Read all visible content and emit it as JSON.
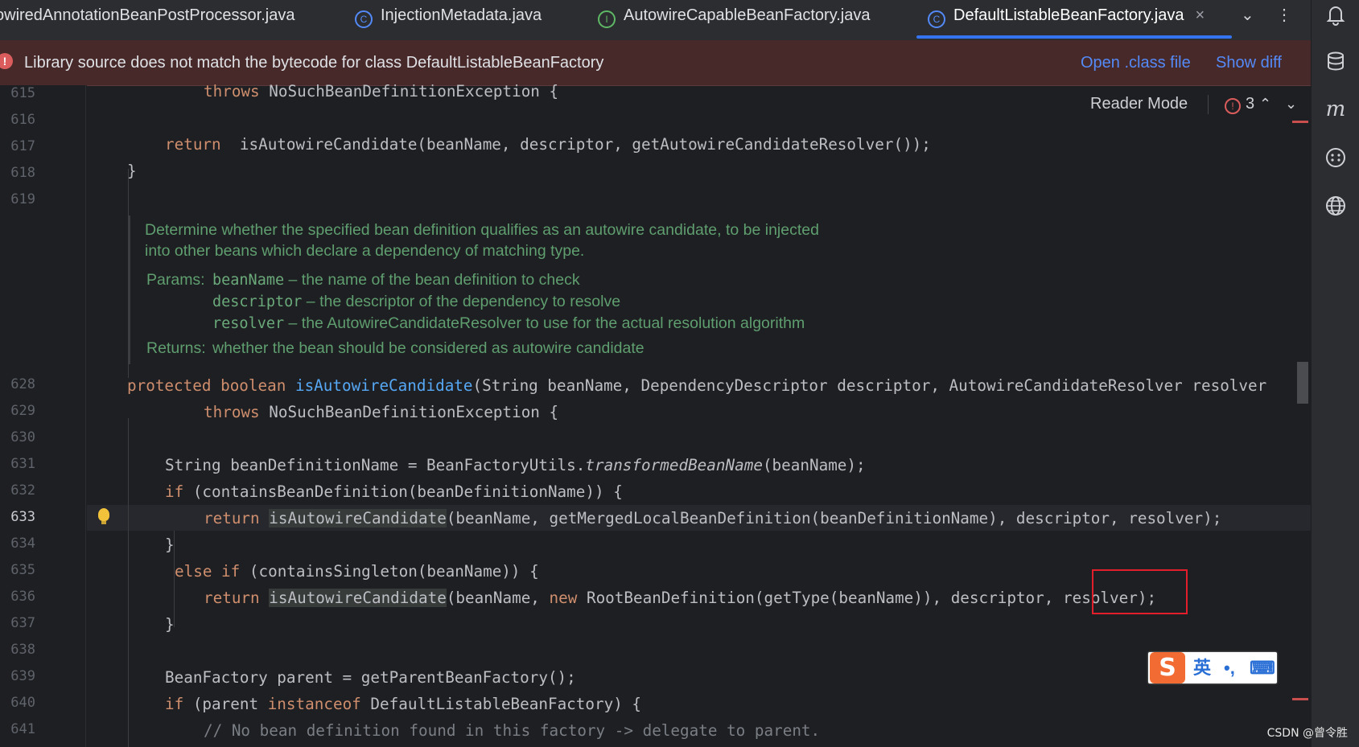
{
  "tabs": [
    {
      "label": "owiredAnnotationBeanPostProcessor.java",
      "icon": "class-icon"
    },
    {
      "label": "InjectionMetadata.java",
      "icon": "class-icon"
    },
    {
      "label": "AutowireCapableBeanFactory.java",
      "icon": "interface-icon"
    },
    {
      "label": "DefaultListableBeanFactory.java",
      "icon": "class-icon",
      "active": true
    }
  ],
  "icon_glyphs": {
    "class": "C",
    "interface": "I",
    "close": "×",
    "chevron": "⌄",
    "more": "⋮"
  },
  "banner": {
    "message": "Library source does not match the bytecode for class DefaultListableBeanFactory",
    "open_class": "Open .class file",
    "show_diff": "Show diff"
  },
  "reader_mode": "Reader Mode",
  "error_count": "3",
  "lines": {
    "l615": "615",
    "l616": "616",
    "l617": "617",
    "l618": "618",
    "l619": "619",
    "l628": "628",
    "l629": "629",
    "l630": "630",
    "l631": "631",
    "l632": "632",
    "l633": "633",
    "l634": "634",
    "l635": "635",
    "l636": "636",
    "l637": "637",
    "l638": "638",
    "l639": "639",
    "l640": "640",
    "l641": "641"
  },
  "doc": {
    "line1": "Determine whether the specified bean definition qualifies as an autowire candidate, to be injected",
    "line2": "into other beans which declare a dependency of matching type.",
    "params_label": "Params:",
    "p1_name": "beanName",
    "p1_desc": " – the name of the bean definition to check",
    "p2_name": "descriptor",
    "p2_desc": " – the descriptor of the dependency to resolve",
    "p3_name": "resolver",
    "p3_desc": " – the AutowireCandidateResolver to use for the actual resolution algorithm",
    "returns_label": "Returns:",
    "returns_desc": "whether the bean should be considered as autowire candidate"
  },
  "code": {
    "c615_kw": "throws",
    "c615_rest": " NoSuchBeanDefinitionException {",
    "c617_kw": "return",
    "c617_rest": " isAutowireCandidate(beanName, descriptor, getAutowireCandidateResolver());",
    "c618": "}",
    "c628_kw1": "protected",
    "c628_kw2": "boolean",
    "c628_fn": "isAutowireCandidate",
    "c628_rest": "(String beanName, DependencyDescriptor descriptor, AutowireCandidateResolver resolver",
    "c629_kw": "throws",
    "c629_rest": " NoSuchBeanDefinitionException {",
    "c631_a": "String beanDefinitionName = BeanFactoryUtils.",
    "c631_it": "transformedBeanName",
    "c631_b": "(beanName);",
    "c632_kw": "if",
    "c632_rest": " (containsBeanDefinition(beanDefinitionName)) {",
    "c633_kw": "return",
    "c633_hl": "isAutowireCandidate",
    "c633_rest": "(beanName, getMergedLocalBeanDefinition(beanDefinitionName), descriptor, resolver);",
    "c634": "}",
    "c635_kw": "else if",
    "c635_rest": " (containsSingleton(beanName)) {",
    "c636_kw": "return",
    "c636_hl": "isAutowireCandidate",
    "c636_a": "(beanName, ",
    "c636_kw2": "new",
    "c636_b": " RootBeanDefinition(getType(beanName)), descriptor, resolver);",
    "c637": "}",
    "c639": "BeanFactory parent = getParentBeanFactory();",
    "c640_kw": "if",
    "c640_a": " (parent ",
    "c640_kw2": "instanceof",
    "c640_b": " DefaultListableBeanFactory) {",
    "c641": "// No bean definition found in this factory -> delegate to parent."
  },
  "ime": {
    "logo": "S",
    "lang": "英",
    "punct": "•,",
    "kbd": "⌨"
  },
  "watermark": "CSDN @曾令胜",
  "colors": {
    "keyword": "#cf8e6d",
    "function": "#56a8f5",
    "doc": "#5f9e6f",
    "banner_bg": "#47292a",
    "link": "#548af7",
    "highlight_box": "#e11e2a"
  }
}
